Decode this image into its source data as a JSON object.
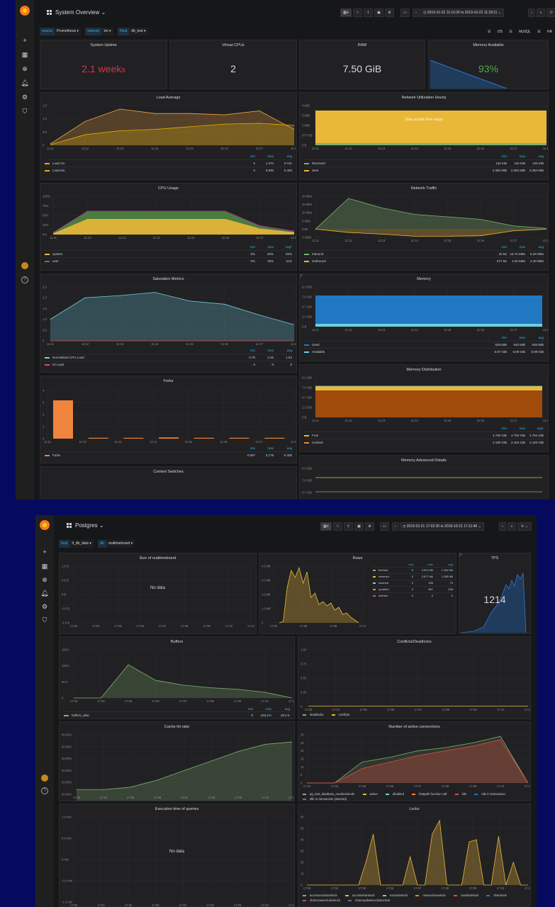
{
  "top": {
    "title": "System Overview",
    "time_range": "2019-10-22 11:10:26 to 2019-10-22 11:18:11",
    "variables": [
      {
        "label": "source",
        "value": "Prometheus"
      },
      {
        "label": "Interval",
        "value": "1m"
      },
      {
        "label": "Host",
        "value": "db_test"
      }
    ],
    "links": [
      "OS",
      "MySQL",
      "HA"
    ],
    "stats": {
      "uptime": {
        "title": "System Uptime",
        "value": "2.1 week",
        "suffix": "s"
      },
      "vcpu": {
        "title": "Virtual CPUs",
        "value": "2"
      },
      "ram": {
        "title": "RAM",
        "value": "7.50 GiB"
      },
      "memavail": {
        "title": "Memory Available",
        "value": "93%"
      }
    },
    "x_ticks": [
      "11:11",
      "11:12",
      "11:13",
      "11:14",
      "11:15",
      "11:16",
      "11:17",
      "11:18"
    ],
    "legend_head": {
      "min": "min",
      "max": "max",
      "avg": "avg"
    },
    "load": {
      "title": "Load Average",
      "y_ticks": [
        "1.5",
        "1.0",
        "0.5",
        "0"
      ],
      "legend": [
        {
          "name": "Load 1m",
          "color": "#f2a33a",
          "min": "0",
          "max": "1.370",
          "avg": "0.741"
        },
        {
          "name": "Load 5m",
          "color": "#e0b400",
          "min": "0",
          "max": "0.830",
          "avg": "0.493"
        }
      ]
    },
    "net_hourly": {
      "title": "Network Utilization Hourly",
      "y_ticks": [
        "4 MiB",
        "3 MiB",
        "2 MiB",
        "977 KiB",
        "0 B"
      ],
      "message": "Data outside time range",
      "legend": [
        {
          "name": "Received",
          "color": "#7eb26d",
          "min": "125 KiB",
          "max": "125 KiB",
          "avg": "125 KiB"
        },
        {
          "name": "Sent",
          "color": "#eab839",
          "min": "3.350 MiB",
          "max": "3.350 MiB",
          "avg": "3.350 MiB"
        }
      ]
    },
    "cpu": {
      "title": "CPU Usage",
      "y_ticks": [
        "100%",
        "75%",
        "50%",
        "25%",
        "0%"
      ],
      "legend_head_avg": "avg*",
      "legend": [
        {
          "name": "system",
          "color": "#eab839",
          "min": "0%",
          "max": "40%",
          "avg": "20%"
        },
        {
          "name": "user",
          "color": "#508642",
          "min": "0%",
          "max": "19%",
          "avg": "11%"
        }
      ]
    },
    "traffic": {
      "title": "Network Traffic",
      "y_ticks": [
        "20 MBs",
        "15 MBs",
        "10 MBs",
        "5 MBs",
        "0 Bs",
        "-5 MBs"
      ],
      "legend": [
        {
          "name": "Inbound",
          "color": "#7eb26d",
          "min": "32 Bs",
          "max": "18.70 MBs",
          "avg": "6.29 MBs"
        },
        {
          "name": "Outbound",
          "color": "#eab839",
          "min": "677 Bs",
          "max": "4.30 MBs",
          "avg": "2.40 MBs"
        }
      ]
    },
    "saturation": {
      "title": "Saturation Metrics",
      "y_ticks": [
        "2.5",
        "2.0",
        "1.5",
        "1.0",
        "0.5",
        "0"
      ],
      "legend": [
        {
          "name": "Normalized CPU Load",
          "color": "#6ed0e0",
          "min": "0.75",
          "max": "2.25",
          "avg": "1.54"
        },
        {
          "name": "IO Load",
          "color": "#e24d42",
          "min": "0",
          "max": "0",
          "avg": "0"
        }
      ]
    },
    "memory": {
      "title": "Memory",
      "y_ticks": [
        "9.3 GiB",
        "7.0 GiB",
        "4.7 GiB",
        "2.3 GiB",
        "0 B"
      ],
      "legend": [
        {
          "name": "Used",
          "color": "#1f78c1",
          "min": "528 MiB",
          "max": "540 MiB",
          "avg": "536 MiB"
        },
        {
          "name": "Available",
          "color": "#6ed0e0",
          "min": "6.97 GiB",
          "max": "6.99 GiB",
          "avg": "6.98 GiB"
        }
      ]
    },
    "forks": {
      "title": "Forks",
      "y_ticks": [
        "4",
        "3",
        "2",
        "1",
        "0"
      ],
      "legend": [
        {
          "name": "Forks",
          "color": "#ef843c",
          "min": "0.067",
          "max": "3.178",
          "avg": "0.405"
        }
      ]
    },
    "memdist": {
      "title": "Memory Distribution",
      "y_ticks": [
        "9.3 GiB",
        "7.0 GiB",
        "4.7 GiB",
        "2.3 GiB",
        "0 B"
      ],
      "legend_head_avg": "avg*",
      "legend": [
        {
          "name": "Free",
          "color": "#eab839",
          "min": "4.780 GiB",
          "max": "4.792 GiB",
          "avg": "4.784 GiB"
        },
        {
          "name": "Cached",
          "color": "#ef843c",
          "min": "2.180 GiB",
          "max": "2.183 GiB",
          "avg": "2.183 GiB"
        }
      ]
    },
    "ctx": {
      "title": "Context Switches"
    },
    "memadv": {
      "title": "Memory Advanced Details",
      "y_ticks": [
        "9.3 GiB",
        "7.0 GiB",
        "4.7 GiB"
      ]
    }
  },
  "bottom": {
    "title": "Postgres",
    "time_range": "2019-10-21 17:02:30 to 2019-10-21 17:11:40",
    "variables": [
      {
        "label": "host",
        "value": "lt_db_data"
      },
      {
        "label": "db",
        "value": "realtimeboard"
      }
    ],
    "x_ticks": [
      "17:03",
      "17:04",
      "17:05",
      "17:06",
      "17:07",
      "17:08",
      "17:09",
      "17:10",
      "17:11"
    ],
    "size": {
      "title": "Size of realtimeboard",
      "y_ticks": [
        "1.0 B",
        "0.5 B",
        "0 B",
        "-0.5 B",
        "-1.0 B"
      ],
      "message": "No data"
    },
    "rows": {
      "title": "Rows",
      "y_ticks": [
        "4.0 Mil",
        "3.0 Mil",
        "2.0 Mil",
        "1.0 Mil",
        "0"
      ],
      "x_ticks": [
        "17:04",
        "17:06",
        "17:08",
        "17:10"
      ],
      "legend_head": {
        "min": "min",
        "max": "max",
        "avg": "avg"
      },
      "legend": [
        {
          "name": "fetched",
          "color": "#7eb26d",
          "min": "0",
          "max": "3.874 Mil",
          "avg": "1.282 Mil"
        },
        {
          "name": "returned",
          "color": "#eab839",
          "min": "0",
          "max": "3.877 Mil",
          "avg": "1.285 Mil"
        },
        {
          "name": "inserted",
          "color": "#6ed0e0",
          "min": "0",
          "max": "189",
          "avg": "79"
        },
        {
          "name": "updated",
          "color": "#ef843c",
          "min": "0",
          "max": "567",
          "avg": "228"
        },
        {
          "name": "deleted",
          "color": "#e24d42",
          "min": "0",
          "max": "0",
          "avg": "0"
        }
      ]
    },
    "tps": {
      "title": "TPS",
      "value": "1214"
    },
    "buffers": {
      "title": "Buffers",
      "y_ticks": [
        "150 K",
        "100 K",
        "50 K",
        "0"
      ],
      "legend_head": {
        "min": "min",
        "max": "max",
        "avg": "avg"
      },
      "legend": [
        {
          "name": "buffers_alloc",
          "color": "#7eb26d",
          "min": "0",
          "max": "103.4 K",
          "avg": "28.2 K"
        }
      ]
    },
    "conflicts": {
      "title": "Conflicts/Deadlocks",
      "y_ticks": [
        "1.00",
        "0.75",
        "0.50",
        "0.25",
        "0"
      ],
      "legend": [
        {
          "name": "deadlocks",
          "color": "#7eb26d"
        },
        {
          "name": "conflicts",
          "color": "#eab839"
        }
      ]
    },
    "cache": {
      "title": "Cache hit ratio",
      "y_ticks": [
        "45.00%",
        "40.00%",
        "35.00%",
        "30.00%",
        "25.00%",
        "20.00%"
      ]
    },
    "active": {
      "title": "Number of active connections",
      "y_ticks": [
        "30",
        "25",
        "20",
        "15",
        "10",
        "5",
        "0"
      ],
      "legend": [
        {
          "name": "pg_stat_database_numbackends",
          "color": "#7eb26d"
        },
        {
          "name": "active",
          "color": "#eab839"
        },
        {
          "name": "disabled",
          "color": "#6ed0e0"
        },
        {
          "name": "fastpath function call",
          "color": "#ef843c"
        },
        {
          "name": "idle",
          "color": "#e24d42"
        },
        {
          "name": "idle in transaction",
          "color": "#1f78c1"
        },
        {
          "name": "idle in transaction (aborted)",
          "color": "#ba43a9"
        }
      ]
    },
    "exec": {
      "title": "Execution time of queries",
      "y_ticks": [
        "1.0 min",
        "0.5 min",
        "0 min",
        "-0.5 min",
        "-1.0 min"
      ],
      "message": "No data"
    },
    "locks": {
      "title": "Locks",
      "y_ticks": [
        "60",
        "50",
        "40",
        "30",
        "20",
        "10",
        "0"
      ],
      "legend": [
        {
          "name": "accessexclusivelock",
          "color": "#7eb26d"
        },
        {
          "name": "accesssharelock",
          "color": "#eab839"
        },
        {
          "name": "exclusivelock",
          "color": "#6ed0e0"
        },
        {
          "name": "rowexclusivelock",
          "color": "#ef843c"
        },
        {
          "name": "rowsharelock",
          "color": "#e24d42"
        },
        {
          "name": "sharelock",
          "color": "#1f78c1"
        },
        {
          "name": "sharerowexclusivelock",
          "color": "#ba43a9"
        },
        {
          "name": "shareupdateexclusivelock",
          "color": "#705da0"
        }
      ]
    }
  },
  "chart_data": [
    {
      "type": "line",
      "title": "Load Average",
      "x": [
        "11:11",
        "11:12",
        "11:13",
        "11:14",
        "11:15",
        "11:16",
        "11:17",
        "11:18"
      ],
      "series": [
        {
          "name": "Load 1m",
          "values": [
            0.05,
            0.9,
            1.37,
            1.2,
            1.2,
            1.15,
            1.3,
            0.6
          ]
        },
        {
          "name": "Load 5m",
          "values": [
            0.02,
            0.4,
            0.55,
            0.6,
            0.7,
            0.8,
            0.83,
            0.75
          ]
        }
      ],
      "ylim": [
        0,
        1.5
      ]
    },
    {
      "type": "area",
      "title": "CPU Usage",
      "x": [
        "11:11",
        "11:12",
        "11:13",
        "11:14",
        "11:15",
        "11:16",
        "11:17",
        "11:18"
      ],
      "series": [
        {
          "name": "system",
          "values": [
            2,
            40,
            40,
            40,
            40,
            40,
            15,
            5
          ]
        },
        {
          "name": "user",
          "values": [
            1,
            19,
            19,
            19,
            19,
            19,
            6,
            2
          ]
        }
      ],
      "ylim": [
        0,
        100
      ]
    },
    {
      "type": "area",
      "title": "Network Traffic",
      "x": [
        "11:11",
        "11:12",
        "11:13",
        "11:14",
        "11:15",
        "11:16",
        "11:17",
        "11:18"
      ],
      "series": [
        {
          "name": "Inbound",
          "values": [
            0,
            18.7,
            13,
            9,
            7.5,
            6,
            2,
            0.5
          ]
        },
        {
          "name": "Outbound",
          "values": [
            0,
            -2,
            -3,
            -4.3,
            -4.3,
            -4,
            -1,
            0
          ]
        }
      ],
      "ylim": [
        -5,
        20
      ]
    },
    {
      "type": "area",
      "title": "Saturation Metrics",
      "x": [
        "11:11",
        "11:12",
        "11:13",
        "11:14",
        "11:15",
        "11:16",
        "11:17",
        "11:18"
      ],
      "series": [
        {
          "name": "Normalized CPU Load",
          "values": [
            1.0,
            2.0,
            2.1,
            2.25,
            1.85,
            1.7,
            1.2,
            0.75
          ]
        },
        {
          "name": "IO Load",
          "values": [
            0,
            0,
            0,
            0,
            0,
            0,
            0,
            0
          ]
        }
      ],
      "ylim": [
        0,
        2.5
      ]
    },
    {
      "type": "bar",
      "title": "Forks",
      "x": [
        "11:11",
        "11:12",
        "11:13",
        "11:14",
        "11:15",
        "11:16",
        "11:17",
        "11:18"
      ],
      "series": [
        {
          "name": "Forks",
          "values": [
            3.178,
            0.067,
            0.067,
            0.1,
            0.067,
            0.067,
            0.067,
            0.067
          ]
        }
      ],
      "ylim": [
        0,
        4
      ]
    },
    {
      "type": "line",
      "title": "Rows",
      "x": [
        "17:04",
        "17:06",
        "17:08",
        "17:10"
      ],
      "series": [
        {
          "name": "fetched",
          "values": [
            0,
            3.87,
            1.4,
            0.6
          ]
        },
        {
          "name": "returned",
          "values": [
            0,
            3.88,
            1.4,
            0.6
          ]
        }
      ],
      "ylim": [
        0,
        4.0
      ]
    },
    {
      "type": "line",
      "title": "Buffers",
      "x": [
        "17:03",
        "17:04",
        "17:05",
        "17:06",
        "17:07",
        "17:08",
        "17:09",
        "17:10",
        "17:11"
      ],
      "series": [
        {
          "name": "buffers_alloc",
          "values": [
            0,
            0,
            103.4,
            55,
            40,
            32,
            27,
            18,
            0
          ]
        }
      ],
      "ylim": [
        0,
        150
      ]
    },
    {
      "type": "line",
      "title": "Cache hit ratio",
      "x": [
        "17:03",
        "17:04",
        "17:05",
        "17:06",
        "17:07",
        "17:08",
        "17:09",
        "17:10",
        "17:11"
      ],
      "series": [
        {
          "name": "Cache hit ratio",
          "values": [
            22,
            22,
            23,
            26,
            30,
            34,
            38,
            41,
            42
          ]
        }
      ],
      "ylim": [
        20,
        45
      ]
    },
    {
      "type": "line",
      "title": "Number of active connections",
      "x": [
        "17:03",
        "17:04",
        "17:05",
        "17:06",
        "17:07",
        "17:08",
        "17:09",
        "17:10",
        "17:11"
      ],
      "series": [
        {
          "name": "pg_stat_database_numbackends",
          "values": [
            0,
            0,
            13,
            16,
            20,
            22,
            25,
            29,
            0
          ]
        },
        {
          "name": "idle",
          "values": [
            0,
            0,
            9,
            13,
            17,
            20,
            23,
            27,
            0
          ]
        }
      ],
      "ylim": [
        0,
        30
      ]
    },
    {
      "type": "line",
      "title": "Locks",
      "x": [
        "17:03",
        "17:04",
        "17:05",
        "17:06",
        "17:07",
        "17:08",
        "17:09",
        "17:10",
        "17:11"
      ],
      "series": [
        {
          "name": "accesssharelock",
          "values": [
            0,
            0,
            45,
            0,
            57,
            40,
            43,
            20,
            0
          ]
        }
      ],
      "ylim": [
        0,
        60
      ]
    }
  ]
}
